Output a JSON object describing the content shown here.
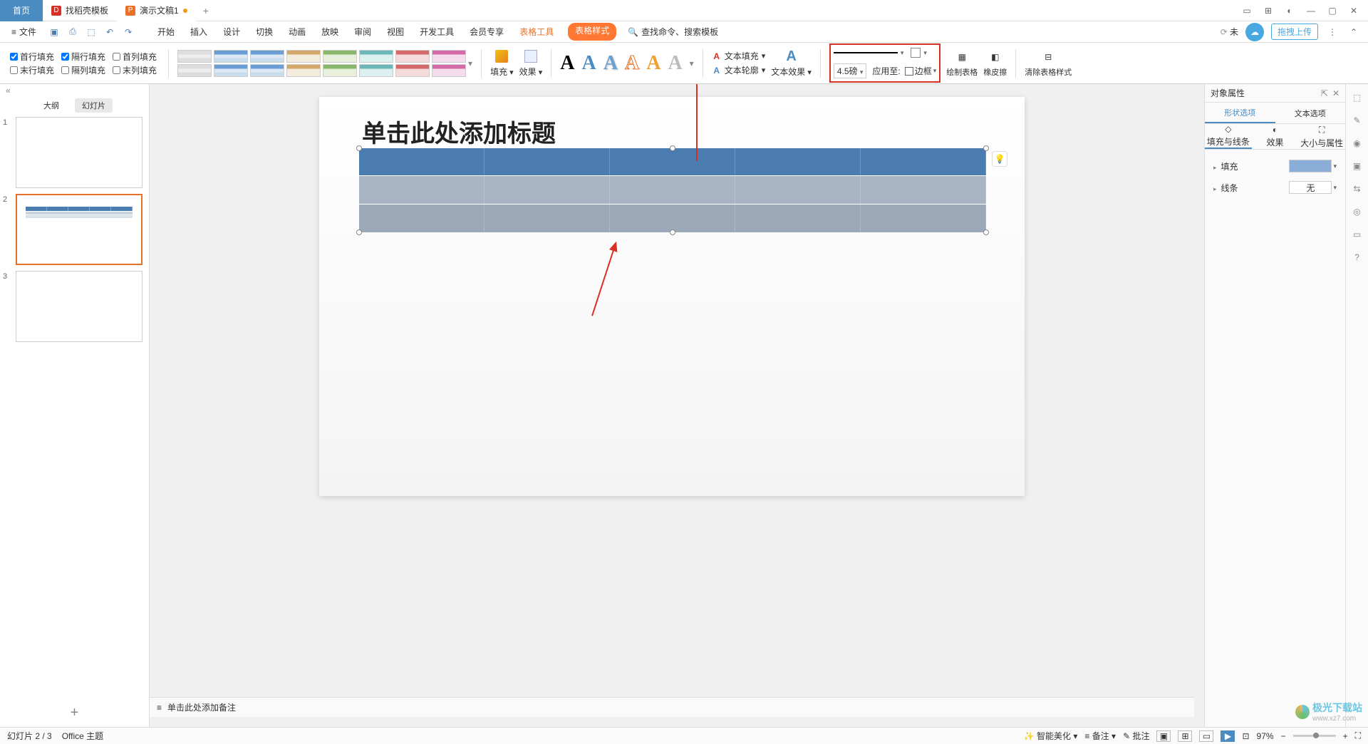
{
  "titlebar": {
    "tabs": [
      {
        "label": "首页",
        "icon": ""
      },
      {
        "label": "找稻壳模板",
        "icon": "D"
      },
      {
        "label": "演示文稿1",
        "icon": "P",
        "modified": true
      }
    ],
    "add": "+"
  },
  "menubar": {
    "file": "文件",
    "tabs": [
      "开始",
      "插入",
      "设计",
      "切换",
      "动画",
      "放映",
      "审阅",
      "视图",
      "开发工具",
      "会员专享"
    ],
    "table_tools": "表格工具",
    "table_style": "表格样式",
    "search_placeholder": "查找命令、搜索模板",
    "unsaved": "未",
    "upload": "拖拽上传"
  },
  "ribbon": {
    "checks": {
      "first_row": "首行填充",
      "alt_row": "隔行填充",
      "first_col": "首列填充",
      "last_row": "末行填充",
      "alt_col": "隔列填充",
      "last_col": "末列填充"
    },
    "fill": "填充",
    "effect": "效果",
    "text_fill": "文本填充",
    "text_outline": "文本轮廓",
    "text_effect": "文本效果",
    "border_weight": "4.5磅",
    "apply_to": "应用至:",
    "border": "边框",
    "draw_table": "绘制表格",
    "eraser": "橡皮擦",
    "clear_style": "清除表格样式"
  },
  "sidepanel": {
    "outline": "大纲",
    "slides": "幻灯片",
    "slide_count": 3,
    "selected": 2
  },
  "slide": {
    "title_placeholder": "单击此处添加标题",
    "table": {
      "cols": 5,
      "rows": 3
    }
  },
  "notes": {
    "placeholder": "单击此处添加备注"
  },
  "rightpanel": {
    "title": "对象属性",
    "tab_shape": "形状选项",
    "tab_text": "文本选项",
    "sub_fill": "填充与线条",
    "sub_effect": "效果",
    "sub_size": "大小与属性",
    "fill_label": "填充",
    "line_label": "线条",
    "line_value": "无"
  },
  "statusbar": {
    "slide_info": "幻灯片 2 / 3",
    "theme": "Office 主题",
    "beautify": "智能美化",
    "notes_btn": "备注",
    "comments": "批注",
    "zoom": "97%"
  },
  "watermark": {
    "name": "极光下载站",
    "url": "www.xz7.com"
  }
}
